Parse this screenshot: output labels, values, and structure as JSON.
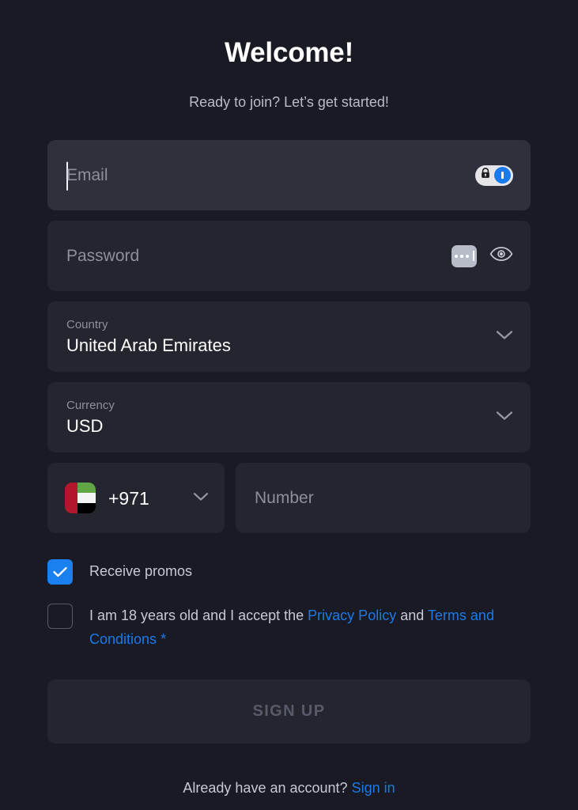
{
  "header": {
    "title": "Welcome!",
    "subtitle": "Ready to join? Let’s get started!"
  },
  "form": {
    "email": {
      "placeholder": "Email",
      "value": "",
      "focused": true,
      "autofill_icons": [
        "lock-icon",
        "onepassword-icon"
      ]
    },
    "password": {
      "placeholder": "Password",
      "value": "",
      "icons": [
        "password-dots-icon",
        "eye-icon"
      ]
    },
    "country": {
      "label": "Country",
      "value": "United Arab Emirates"
    },
    "currency": {
      "label": "Currency",
      "value": "USD"
    },
    "phone": {
      "flag": "ae-flag-icon",
      "dial_code": "+971",
      "number_placeholder": "Number",
      "number_value": ""
    },
    "promos": {
      "label": "Receive promos",
      "checked": true
    },
    "terms": {
      "checked": false,
      "text_before": "I am 18 years old and I accept the ",
      "privacy_link": "Privacy Policy",
      "text_middle": " and ",
      "terms_link": "Terms and Conditions",
      "required_marker": "*"
    },
    "submit_label": "SIGN UP"
  },
  "footer": {
    "prompt": "Already have an account?",
    "signin_label": "Sign in"
  },
  "colors": {
    "page_background": "#191a23",
    "field_background": "#24252f",
    "field_focused_background": "#2f303c",
    "accent_blue": "#1a7aeb",
    "checkbox_blue": "#1a80f0",
    "text_primary": "#ffffff",
    "text_muted": "#8d8f9b",
    "disabled_button_text": "#575a68"
  }
}
